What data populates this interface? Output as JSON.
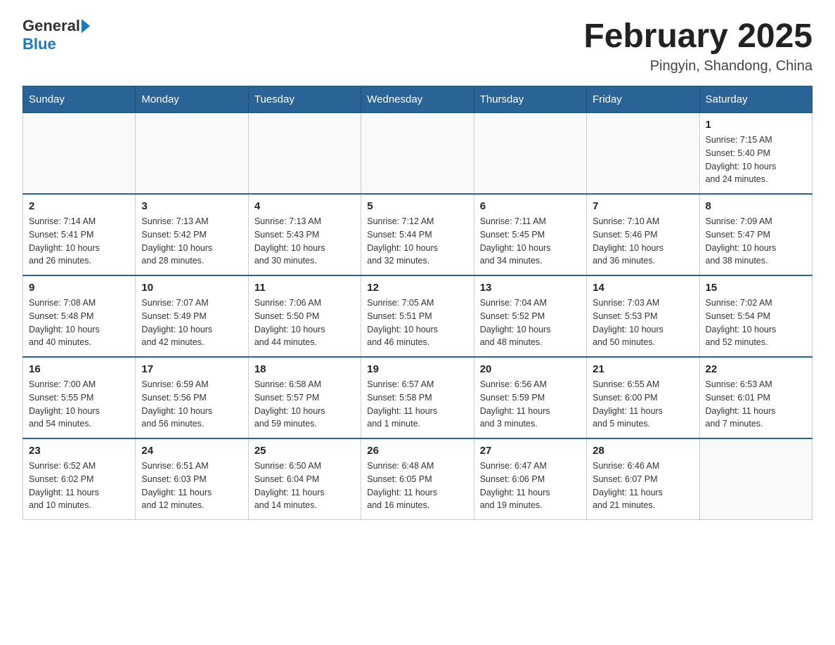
{
  "header": {
    "logo_general": "General",
    "logo_blue": "Blue",
    "month_title": "February 2025",
    "location": "Pingyin, Shandong, China"
  },
  "days_of_week": [
    "Sunday",
    "Monday",
    "Tuesday",
    "Wednesday",
    "Thursday",
    "Friday",
    "Saturday"
  ],
  "weeks": [
    [
      {
        "day": "",
        "info": ""
      },
      {
        "day": "",
        "info": ""
      },
      {
        "day": "",
        "info": ""
      },
      {
        "day": "",
        "info": ""
      },
      {
        "day": "",
        "info": ""
      },
      {
        "day": "",
        "info": ""
      },
      {
        "day": "1",
        "info": "Sunrise: 7:15 AM\nSunset: 5:40 PM\nDaylight: 10 hours\nand 24 minutes."
      }
    ],
    [
      {
        "day": "2",
        "info": "Sunrise: 7:14 AM\nSunset: 5:41 PM\nDaylight: 10 hours\nand 26 minutes."
      },
      {
        "day": "3",
        "info": "Sunrise: 7:13 AM\nSunset: 5:42 PM\nDaylight: 10 hours\nand 28 minutes."
      },
      {
        "day": "4",
        "info": "Sunrise: 7:13 AM\nSunset: 5:43 PM\nDaylight: 10 hours\nand 30 minutes."
      },
      {
        "day": "5",
        "info": "Sunrise: 7:12 AM\nSunset: 5:44 PM\nDaylight: 10 hours\nand 32 minutes."
      },
      {
        "day": "6",
        "info": "Sunrise: 7:11 AM\nSunset: 5:45 PM\nDaylight: 10 hours\nand 34 minutes."
      },
      {
        "day": "7",
        "info": "Sunrise: 7:10 AM\nSunset: 5:46 PM\nDaylight: 10 hours\nand 36 minutes."
      },
      {
        "day": "8",
        "info": "Sunrise: 7:09 AM\nSunset: 5:47 PM\nDaylight: 10 hours\nand 38 minutes."
      }
    ],
    [
      {
        "day": "9",
        "info": "Sunrise: 7:08 AM\nSunset: 5:48 PM\nDaylight: 10 hours\nand 40 minutes."
      },
      {
        "day": "10",
        "info": "Sunrise: 7:07 AM\nSunset: 5:49 PM\nDaylight: 10 hours\nand 42 minutes."
      },
      {
        "day": "11",
        "info": "Sunrise: 7:06 AM\nSunset: 5:50 PM\nDaylight: 10 hours\nand 44 minutes."
      },
      {
        "day": "12",
        "info": "Sunrise: 7:05 AM\nSunset: 5:51 PM\nDaylight: 10 hours\nand 46 minutes."
      },
      {
        "day": "13",
        "info": "Sunrise: 7:04 AM\nSunset: 5:52 PM\nDaylight: 10 hours\nand 48 minutes."
      },
      {
        "day": "14",
        "info": "Sunrise: 7:03 AM\nSunset: 5:53 PM\nDaylight: 10 hours\nand 50 minutes."
      },
      {
        "day": "15",
        "info": "Sunrise: 7:02 AM\nSunset: 5:54 PM\nDaylight: 10 hours\nand 52 minutes."
      }
    ],
    [
      {
        "day": "16",
        "info": "Sunrise: 7:00 AM\nSunset: 5:55 PM\nDaylight: 10 hours\nand 54 minutes."
      },
      {
        "day": "17",
        "info": "Sunrise: 6:59 AM\nSunset: 5:56 PM\nDaylight: 10 hours\nand 56 minutes."
      },
      {
        "day": "18",
        "info": "Sunrise: 6:58 AM\nSunset: 5:57 PM\nDaylight: 10 hours\nand 59 minutes."
      },
      {
        "day": "19",
        "info": "Sunrise: 6:57 AM\nSunset: 5:58 PM\nDaylight: 11 hours\nand 1 minute."
      },
      {
        "day": "20",
        "info": "Sunrise: 6:56 AM\nSunset: 5:59 PM\nDaylight: 11 hours\nand 3 minutes."
      },
      {
        "day": "21",
        "info": "Sunrise: 6:55 AM\nSunset: 6:00 PM\nDaylight: 11 hours\nand 5 minutes."
      },
      {
        "day": "22",
        "info": "Sunrise: 6:53 AM\nSunset: 6:01 PM\nDaylight: 11 hours\nand 7 minutes."
      }
    ],
    [
      {
        "day": "23",
        "info": "Sunrise: 6:52 AM\nSunset: 6:02 PM\nDaylight: 11 hours\nand 10 minutes."
      },
      {
        "day": "24",
        "info": "Sunrise: 6:51 AM\nSunset: 6:03 PM\nDaylight: 11 hours\nand 12 minutes."
      },
      {
        "day": "25",
        "info": "Sunrise: 6:50 AM\nSunset: 6:04 PM\nDaylight: 11 hours\nand 14 minutes."
      },
      {
        "day": "26",
        "info": "Sunrise: 6:48 AM\nSunset: 6:05 PM\nDaylight: 11 hours\nand 16 minutes."
      },
      {
        "day": "27",
        "info": "Sunrise: 6:47 AM\nSunset: 6:06 PM\nDaylight: 11 hours\nand 19 minutes."
      },
      {
        "day": "28",
        "info": "Sunrise: 6:46 AM\nSunset: 6:07 PM\nDaylight: 11 hours\nand 21 minutes."
      },
      {
        "day": "",
        "info": ""
      }
    ]
  ]
}
